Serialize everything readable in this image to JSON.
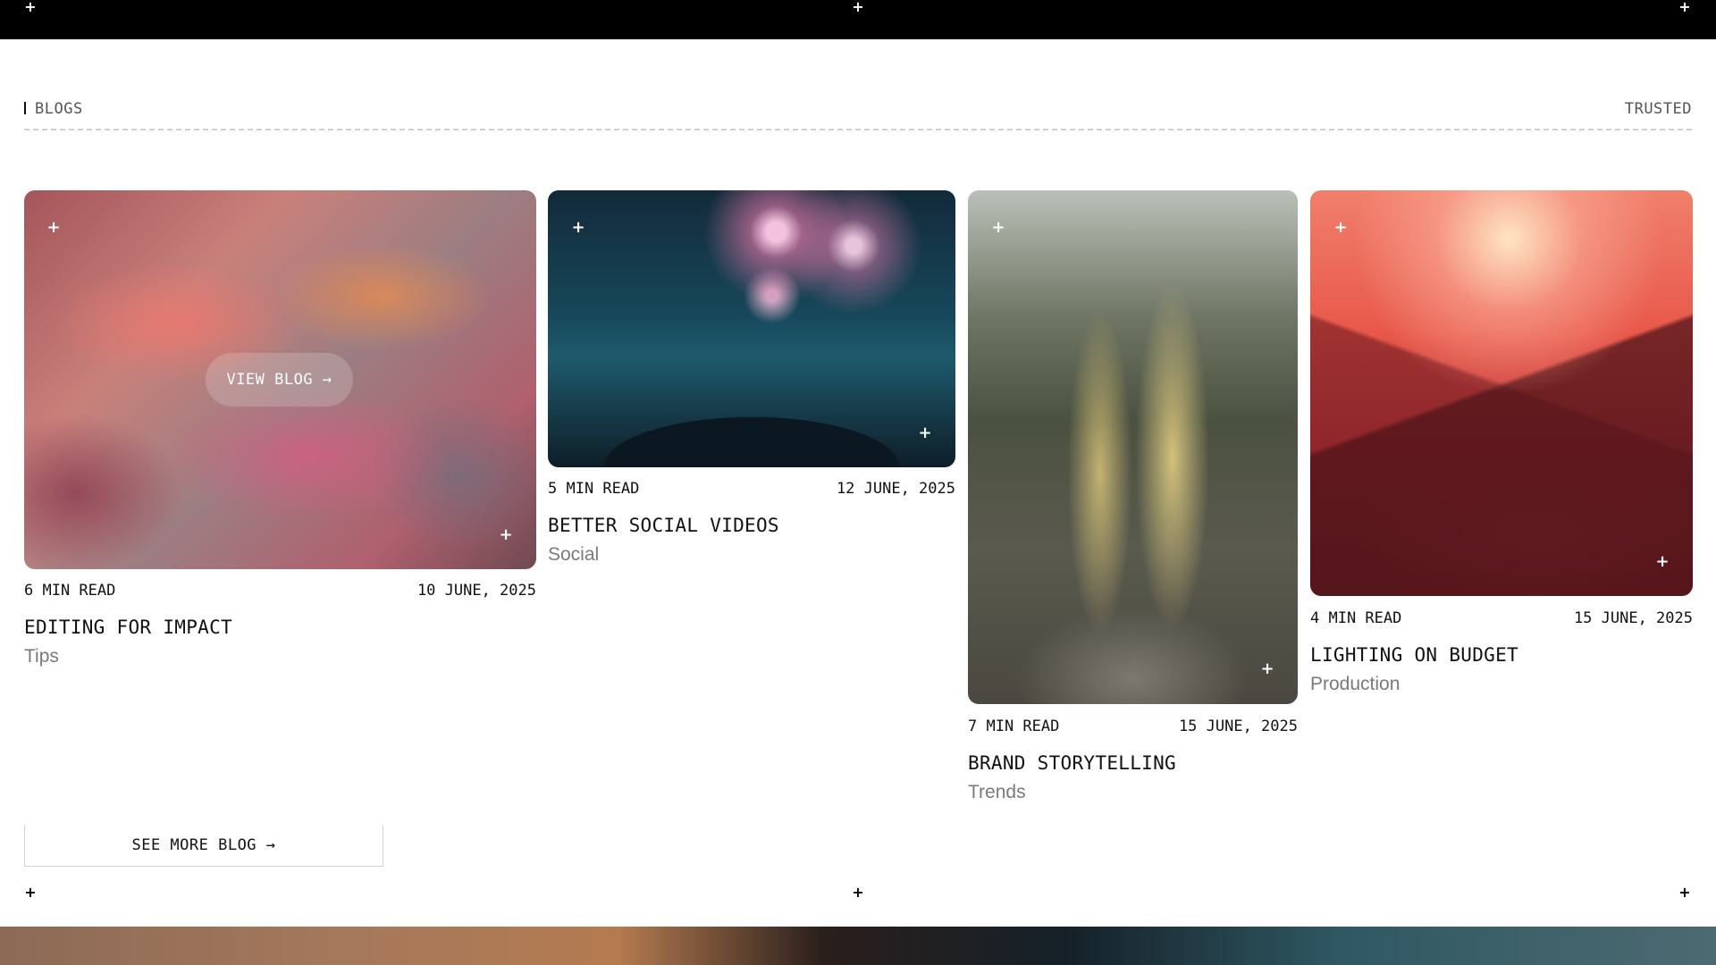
{
  "section": {
    "label": "BLOGS",
    "right_label": "TRUSTED"
  },
  "cards": [
    {
      "read_time": "6 MIN READ",
      "date": "10 JUNE, 2025",
      "title": "EDITING FOR IMPACT",
      "category": "Tips",
      "overlay_button": "VIEW BLOG →"
    },
    {
      "read_time": "5 MIN READ",
      "date": "12 JUNE, 2025",
      "title": "BETTER SOCIAL VIDEOS",
      "category": "Social"
    },
    {
      "read_time": "7 MIN READ",
      "date": "15 JUNE, 2025",
      "title": "BRAND STORYTELLING",
      "category": "Trends"
    },
    {
      "read_time": "4 MIN READ",
      "date": "15 JUNE, 2025",
      "title": "LIGHTING ON BUDGET",
      "category": "Production"
    }
  ],
  "see_more": {
    "label": "SEE MORE BLOG →"
  },
  "decor": {
    "plus_glyph": "+"
  },
  "colors": {
    "background": "#ffffff",
    "text": "#111111",
    "muted": "#7a7a7a",
    "top_bar": "#000000"
  }
}
